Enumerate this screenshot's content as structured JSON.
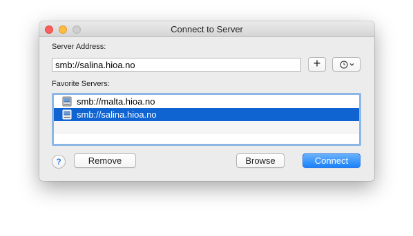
{
  "window": {
    "title": "Connect to Server"
  },
  "server_address": {
    "label": "Server Address:",
    "value": "smb://salina.hioa.no"
  },
  "toolbar": {
    "add_label": "+",
    "action_icon": "recent-clock-icon"
  },
  "favorites": {
    "label": "Favorite Servers:",
    "items": [
      {
        "label": "smb://malta.hioa.no",
        "icon": "server-icon",
        "selected": false
      },
      {
        "label": "smb://salina.hioa.no",
        "icon": "server-icon",
        "selected": true
      }
    ]
  },
  "buttons": {
    "help_label": "?",
    "remove_label": "Remove",
    "browse_label": "Browse",
    "connect_label": "Connect"
  },
  "colors": {
    "selection": "#0f64d2",
    "accent": "#1a82fb",
    "close": "#fc605c",
    "minimize": "#fdbc40",
    "zoom": "#cfcfcf"
  }
}
